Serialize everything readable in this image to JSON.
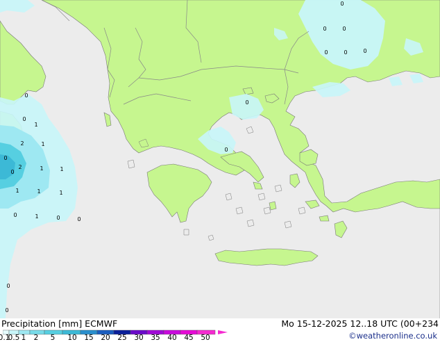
{
  "header": {
    "title_left": "Precipitation [mm]  ECMWF",
    "valid_time": "Mo 15-12-2025 12..18 UTC (00+234",
    "credit": "©weatheronline.co.uk"
  },
  "colors": {
    "sea": "#ececec",
    "land": "#c6f68f",
    "border": "#888888",
    "coast": "#777777",
    "precip_light": "#c8f6fa",
    "precip_mid": "#9ee8f2",
    "precip_strong": "#56cfe1",
    "precip_heavy": "#3cb9d6"
  },
  "legend": {
    "labels": [
      "0.1",
      "0.5",
      "1",
      "2",
      "5",
      "10",
      "15",
      "20",
      "25",
      "30",
      "35",
      "40",
      "45",
      "50"
    ],
    "colors": [
      "#e6fcfe",
      "#c8f6fa",
      "#9ee8f2",
      "#78dbe9",
      "#56cfe1",
      "#3cb9d6",
      "#2a8fcd",
      "#1b5dbf",
      "#0a1f9a",
      "#6a0ac9",
      "#a00ad6",
      "#c80adc",
      "#e60ad6",
      "#f52ad0"
    ]
  },
  "point_labels": [
    {
      "text": "0"
    },
    {
      "text": "0"
    },
    {
      "text": "0"
    },
    {
      "text": "0"
    },
    {
      "text": "0"
    },
    {
      "text": "0"
    },
    {
      "text": "0"
    },
    {
      "text": "0"
    },
    {
      "text": "0"
    },
    {
      "text": "0"
    },
    {
      "text": "0"
    },
    {
      "text": "0"
    },
    {
      "text": "0"
    },
    {
      "text": "0"
    },
    {
      "text": "0"
    },
    {
      "text": "0"
    },
    {
      "text": "0"
    },
    {
      "text": "2"
    },
    {
      "text": "2"
    },
    {
      "text": "1"
    },
    {
      "text": "1"
    },
    {
      "text": "1"
    },
    {
      "text": "1"
    },
    {
      "text": "1"
    },
    {
      "text": "1"
    },
    {
      "text": "1"
    },
    {
      "text": "1"
    }
  ]
}
